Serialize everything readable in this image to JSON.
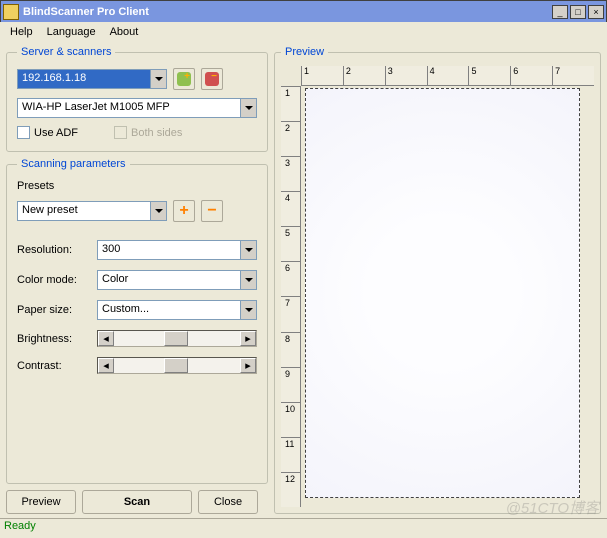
{
  "window": {
    "title": "BlindScanner Pro Client"
  },
  "menu": {
    "help": "Help",
    "language": "Language",
    "about": "About"
  },
  "server_group": {
    "legend": "Server & scanners",
    "server_ip": "192.168.1.18",
    "scanner": "WIA-HP LaserJet M1005 MFP",
    "use_adf_label": "Use ADF",
    "both_sides_label": "Both sides"
  },
  "params_group": {
    "legend": "Scanning parameters",
    "presets_label": "Presets",
    "preset": "New preset",
    "resolution_label": "Resolution:",
    "resolution": "300",
    "colormode_label": "Color mode:",
    "colormode": "Color",
    "papersize_label": "Paper size:",
    "papersize": "Custom...",
    "brightness_label": "Brightness:",
    "contrast_label": "Contrast:"
  },
  "buttons": {
    "preview": "Preview",
    "scan": "Scan",
    "close": "Close"
  },
  "preview_group": {
    "legend": "Preview"
  },
  "ruler_h": [
    "1",
    "2",
    "3",
    "4",
    "5",
    "6",
    "7"
  ],
  "ruler_v": [
    "1",
    "2",
    "3",
    "4",
    "5",
    "6",
    "7",
    "8",
    "9",
    "10",
    "11",
    "12"
  ],
  "status": "Ready",
  "watermark": "@51CTO博客"
}
